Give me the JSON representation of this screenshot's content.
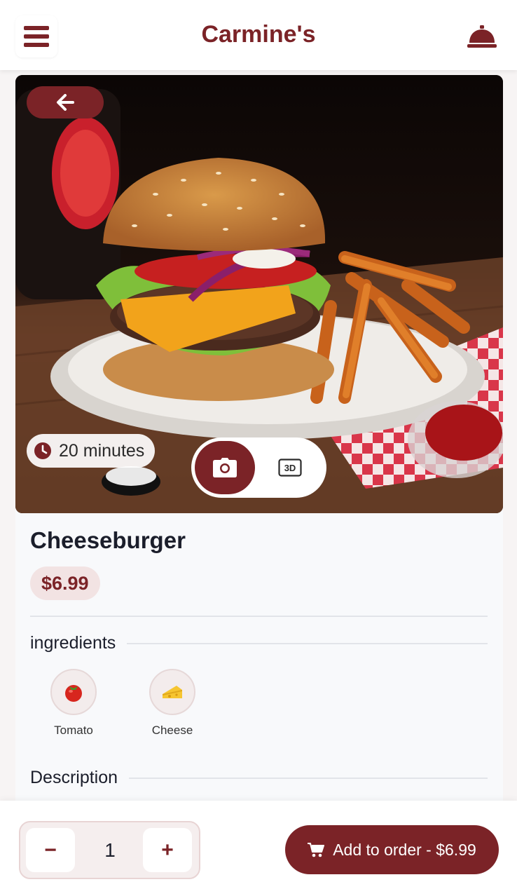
{
  "header": {
    "title": "Carmine's",
    "menu_icon": "hamburger-menu-icon",
    "bell_icon": "service-bell-icon"
  },
  "dish": {
    "name": "Cheeseburger",
    "price": "$6.99",
    "prep_time": "20 minutes",
    "image_alt": "cheeseburger with fries and ketchup",
    "views": [
      {
        "icon": "camera-icon",
        "label": "",
        "active": true
      },
      {
        "icon": "3d-icon",
        "label": "3D",
        "active": false
      }
    ]
  },
  "sections": {
    "ingredients_label": "ingredients",
    "description_label": "Description"
  },
  "ingredients": [
    {
      "name": "Tomato",
      "emoji": "🍅"
    },
    {
      "name": "Cheese",
      "emoji": "🧀"
    }
  ],
  "order": {
    "quantity": "1",
    "minus": "−",
    "plus": "+",
    "add_label": "Add to order - $6.99"
  },
  "colors": {
    "brand": "#7b2327",
    "badge_bg": "#f2e3e3"
  }
}
